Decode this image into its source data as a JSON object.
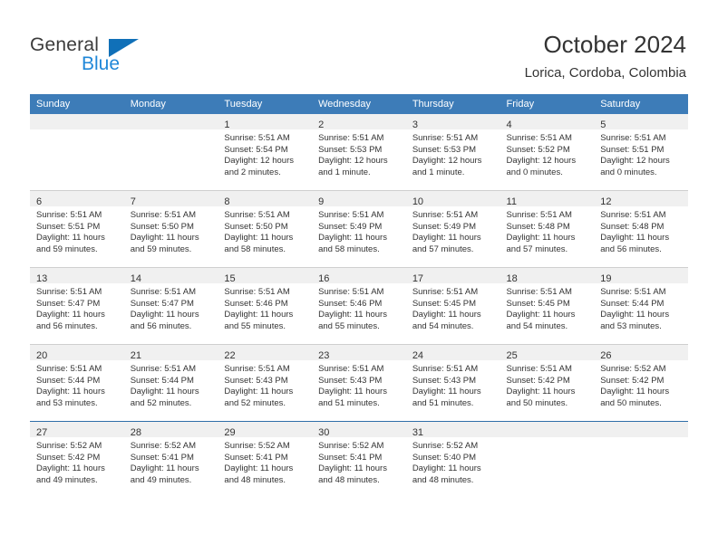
{
  "brand": {
    "name_top": "General",
    "name_bottom": "Blue",
    "triangle_color": "#1070b8",
    "blue_text_color": "#1f87d8"
  },
  "header": {
    "title": "October 2024",
    "subtitle": "Lorica, Cordoba, Colombia"
  },
  "theme": {
    "header_row_bg": "#3d7cb8",
    "daynum_band_bg": "#f0f0f0",
    "grid_line": "#cfcfcf",
    "accent_line": "#2f6ea8",
    "text": "#333333"
  },
  "weekday_headers": [
    "Sunday",
    "Monday",
    "Tuesday",
    "Wednesday",
    "Thursday",
    "Friday",
    "Saturday"
  ],
  "labels": {
    "sunrise_prefix": "Sunrise:",
    "sunset_prefix": "Sunset:",
    "daylight_prefix": "Daylight:"
  },
  "weeks": [
    [
      {
        "day": "",
        "sunrise": "",
        "sunset": "",
        "daylight_1": "",
        "daylight_2": "",
        "empty": true
      },
      {
        "day": "",
        "sunrise": "",
        "sunset": "",
        "daylight_1": "",
        "daylight_2": "",
        "empty": true
      },
      {
        "day": "1",
        "sunrise": "Sunrise: 5:51 AM",
        "sunset": "Sunset: 5:54 PM",
        "daylight_1": "Daylight: 12 hours",
        "daylight_2": "and 2 minutes."
      },
      {
        "day": "2",
        "sunrise": "Sunrise: 5:51 AM",
        "sunset": "Sunset: 5:53 PM",
        "daylight_1": "Daylight: 12 hours",
        "daylight_2": "and 1 minute."
      },
      {
        "day": "3",
        "sunrise": "Sunrise: 5:51 AM",
        "sunset": "Sunset: 5:53 PM",
        "daylight_1": "Daylight: 12 hours",
        "daylight_2": "and 1 minute."
      },
      {
        "day": "4",
        "sunrise": "Sunrise: 5:51 AM",
        "sunset": "Sunset: 5:52 PM",
        "daylight_1": "Daylight: 12 hours",
        "daylight_2": "and 0 minutes."
      },
      {
        "day": "5",
        "sunrise": "Sunrise: 5:51 AM",
        "sunset": "Sunset: 5:51 PM",
        "daylight_1": "Daylight: 12 hours",
        "daylight_2": "and 0 minutes."
      }
    ],
    [
      {
        "day": "6",
        "sunrise": "Sunrise: 5:51 AM",
        "sunset": "Sunset: 5:51 PM",
        "daylight_1": "Daylight: 11 hours",
        "daylight_2": "and 59 minutes."
      },
      {
        "day": "7",
        "sunrise": "Sunrise: 5:51 AM",
        "sunset": "Sunset: 5:50 PM",
        "daylight_1": "Daylight: 11 hours",
        "daylight_2": "and 59 minutes."
      },
      {
        "day": "8",
        "sunrise": "Sunrise: 5:51 AM",
        "sunset": "Sunset: 5:50 PM",
        "daylight_1": "Daylight: 11 hours",
        "daylight_2": "and 58 minutes."
      },
      {
        "day": "9",
        "sunrise": "Sunrise: 5:51 AM",
        "sunset": "Sunset: 5:49 PM",
        "daylight_1": "Daylight: 11 hours",
        "daylight_2": "and 58 minutes."
      },
      {
        "day": "10",
        "sunrise": "Sunrise: 5:51 AM",
        "sunset": "Sunset: 5:49 PM",
        "daylight_1": "Daylight: 11 hours",
        "daylight_2": "and 57 minutes."
      },
      {
        "day": "11",
        "sunrise": "Sunrise: 5:51 AM",
        "sunset": "Sunset: 5:48 PM",
        "daylight_1": "Daylight: 11 hours",
        "daylight_2": "and 57 minutes."
      },
      {
        "day": "12",
        "sunrise": "Sunrise: 5:51 AM",
        "sunset": "Sunset: 5:48 PM",
        "daylight_1": "Daylight: 11 hours",
        "daylight_2": "and 56 minutes."
      }
    ],
    [
      {
        "day": "13",
        "sunrise": "Sunrise: 5:51 AM",
        "sunset": "Sunset: 5:47 PM",
        "daylight_1": "Daylight: 11 hours",
        "daylight_2": "and 56 minutes."
      },
      {
        "day": "14",
        "sunrise": "Sunrise: 5:51 AM",
        "sunset": "Sunset: 5:47 PM",
        "daylight_1": "Daylight: 11 hours",
        "daylight_2": "and 56 minutes."
      },
      {
        "day": "15",
        "sunrise": "Sunrise: 5:51 AM",
        "sunset": "Sunset: 5:46 PM",
        "daylight_1": "Daylight: 11 hours",
        "daylight_2": "and 55 minutes."
      },
      {
        "day": "16",
        "sunrise": "Sunrise: 5:51 AM",
        "sunset": "Sunset: 5:46 PM",
        "daylight_1": "Daylight: 11 hours",
        "daylight_2": "and 55 minutes."
      },
      {
        "day": "17",
        "sunrise": "Sunrise: 5:51 AM",
        "sunset": "Sunset: 5:45 PM",
        "daylight_1": "Daylight: 11 hours",
        "daylight_2": "and 54 minutes."
      },
      {
        "day": "18",
        "sunrise": "Sunrise: 5:51 AM",
        "sunset": "Sunset: 5:45 PM",
        "daylight_1": "Daylight: 11 hours",
        "daylight_2": "and 54 minutes."
      },
      {
        "day": "19",
        "sunrise": "Sunrise: 5:51 AM",
        "sunset": "Sunset: 5:44 PM",
        "daylight_1": "Daylight: 11 hours",
        "daylight_2": "and 53 minutes."
      }
    ],
    [
      {
        "day": "20",
        "sunrise": "Sunrise: 5:51 AM",
        "sunset": "Sunset: 5:44 PM",
        "daylight_1": "Daylight: 11 hours",
        "daylight_2": "and 53 minutes."
      },
      {
        "day": "21",
        "sunrise": "Sunrise: 5:51 AM",
        "sunset": "Sunset: 5:44 PM",
        "daylight_1": "Daylight: 11 hours",
        "daylight_2": "and 52 minutes."
      },
      {
        "day": "22",
        "sunrise": "Sunrise: 5:51 AM",
        "sunset": "Sunset: 5:43 PM",
        "daylight_1": "Daylight: 11 hours",
        "daylight_2": "and 52 minutes."
      },
      {
        "day": "23",
        "sunrise": "Sunrise: 5:51 AM",
        "sunset": "Sunset: 5:43 PM",
        "daylight_1": "Daylight: 11 hours",
        "daylight_2": "and 51 minutes."
      },
      {
        "day": "24",
        "sunrise": "Sunrise: 5:51 AM",
        "sunset": "Sunset: 5:43 PM",
        "daylight_1": "Daylight: 11 hours",
        "daylight_2": "and 51 minutes."
      },
      {
        "day": "25",
        "sunrise": "Sunrise: 5:51 AM",
        "sunset": "Sunset: 5:42 PM",
        "daylight_1": "Daylight: 11 hours",
        "daylight_2": "and 50 minutes."
      },
      {
        "day": "26",
        "sunrise": "Sunrise: 5:52 AM",
        "sunset": "Sunset: 5:42 PM",
        "daylight_1": "Daylight: 11 hours",
        "daylight_2": "and 50 minutes."
      }
    ],
    [
      {
        "day": "27",
        "sunrise": "Sunrise: 5:52 AM",
        "sunset": "Sunset: 5:42 PM",
        "daylight_1": "Daylight: 11 hours",
        "daylight_2": "and 49 minutes."
      },
      {
        "day": "28",
        "sunrise": "Sunrise: 5:52 AM",
        "sunset": "Sunset: 5:41 PM",
        "daylight_1": "Daylight: 11 hours",
        "daylight_2": "and 49 minutes."
      },
      {
        "day": "29",
        "sunrise": "Sunrise: 5:52 AM",
        "sunset": "Sunset: 5:41 PM",
        "daylight_1": "Daylight: 11 hours",
        "daylight_2": "and 48 minutes."
      },
      {
        "day": "30",
        "sunrise": "Sunrise: 5:52 AM",
        "sunset": "Sunset: 5:41 PM",
        "daylight_1": "Daylight: 11 hours",
        "daylight_2": "and 48 minutes."
      },
      {
        "day": "31",
        "sunrise": "Sunrise: 5:52 AM",
        "sunset": "Sunset: 5:40 PM",
        "daylight_1": "Daylight: 11 hours",
        "daylight_2": "and 48 minutes."
      },
      {
        "day": "",
        "sunrise": "",
        "sunset": "",
        "daylight_1": "",
        "daylight_2": "",
        "empty": true
      },
      {
        "day": "",
        "sunrise": "",
        "sunset": "",
        "daylight_1": "",
        "daylight_2": "",
        "empty": true
      }
    ]
  ]
}
